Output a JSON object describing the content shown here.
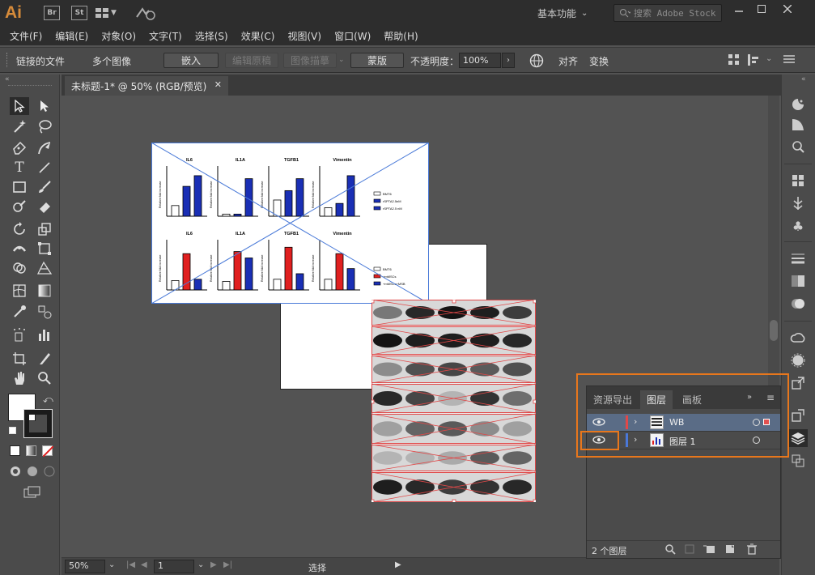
{
  "titlebar": {
    "logo": "Ai",
    "apps": [
      "Br",
      "St"
    ],
    "workspace": "基本功能",
    "search_placeholder": "搜索 Adobe Stock"
  },
  "menu": [
    "文件(F)",
    "编辑(E)",
    "对象(O)",
    "文字(T)",
    "选择(S)",
    "效果(C)",
    "视图(V)",
    "窗口(W)",
    "帮助(H)"
  ],
  "control": {
    "linked_file": "链接的文件",
    "multiple_images": "多个图像",
    "embed": "嵌入",
    "edit_original": "编辑原稿",
    "image_trace": "图像描摹",
    "mask": "蒙版",
    "opacity_label": "不透明度：",
    "opacity_value": "100%",
    "align": "对齐",
    "transform": "变换"
  },
  "document": {
    "tab_title": "未标题-1* @ 50% (RGB/预览)"
  },
  "status": {
    "zoom": "50%",
    "page": "1",
    "tool": "选择"
  },
  "layers_panel": {
    "tabs": [
      "资源导出",
      "图层",
      "画板"
    ],
    "active_tab": "图层",
    "layers": [
      {
        "name": "WB",
        "color": "#e04848",
        "selected": true
      },
      {
        "name": "图层 1",
        "color": "#4a78d8",
        "selected": false
      }
    ],
    "count": "2 个图层"
  },
  "figure": {
    "top_titles": [
      "IL6",
      "IL1A",
      "TGFB1",
      "Vimentin"
    ],
    "bottom_titles": [
      "IL6",
      "IL1A",
      "TGFB1",
      "Vimentin"
    ],
    "ylabel": "Relative fold increase",
    "legend_top": [
      "BMT6",
      "rSPTA2.5nM",
      "rSPTA2.5 nM"
    ],
    "legend_bottom": [
      "BMT6",
      "+mMSCs",
      "+mMSCs+MSB"
    ]
  },
  "colors": {
    "accent": "#e8771c",
    "selection": "#e04848",
    "bar_blue": "#1a2fb5",
    "bar_red": "#e02020"
  }
}
